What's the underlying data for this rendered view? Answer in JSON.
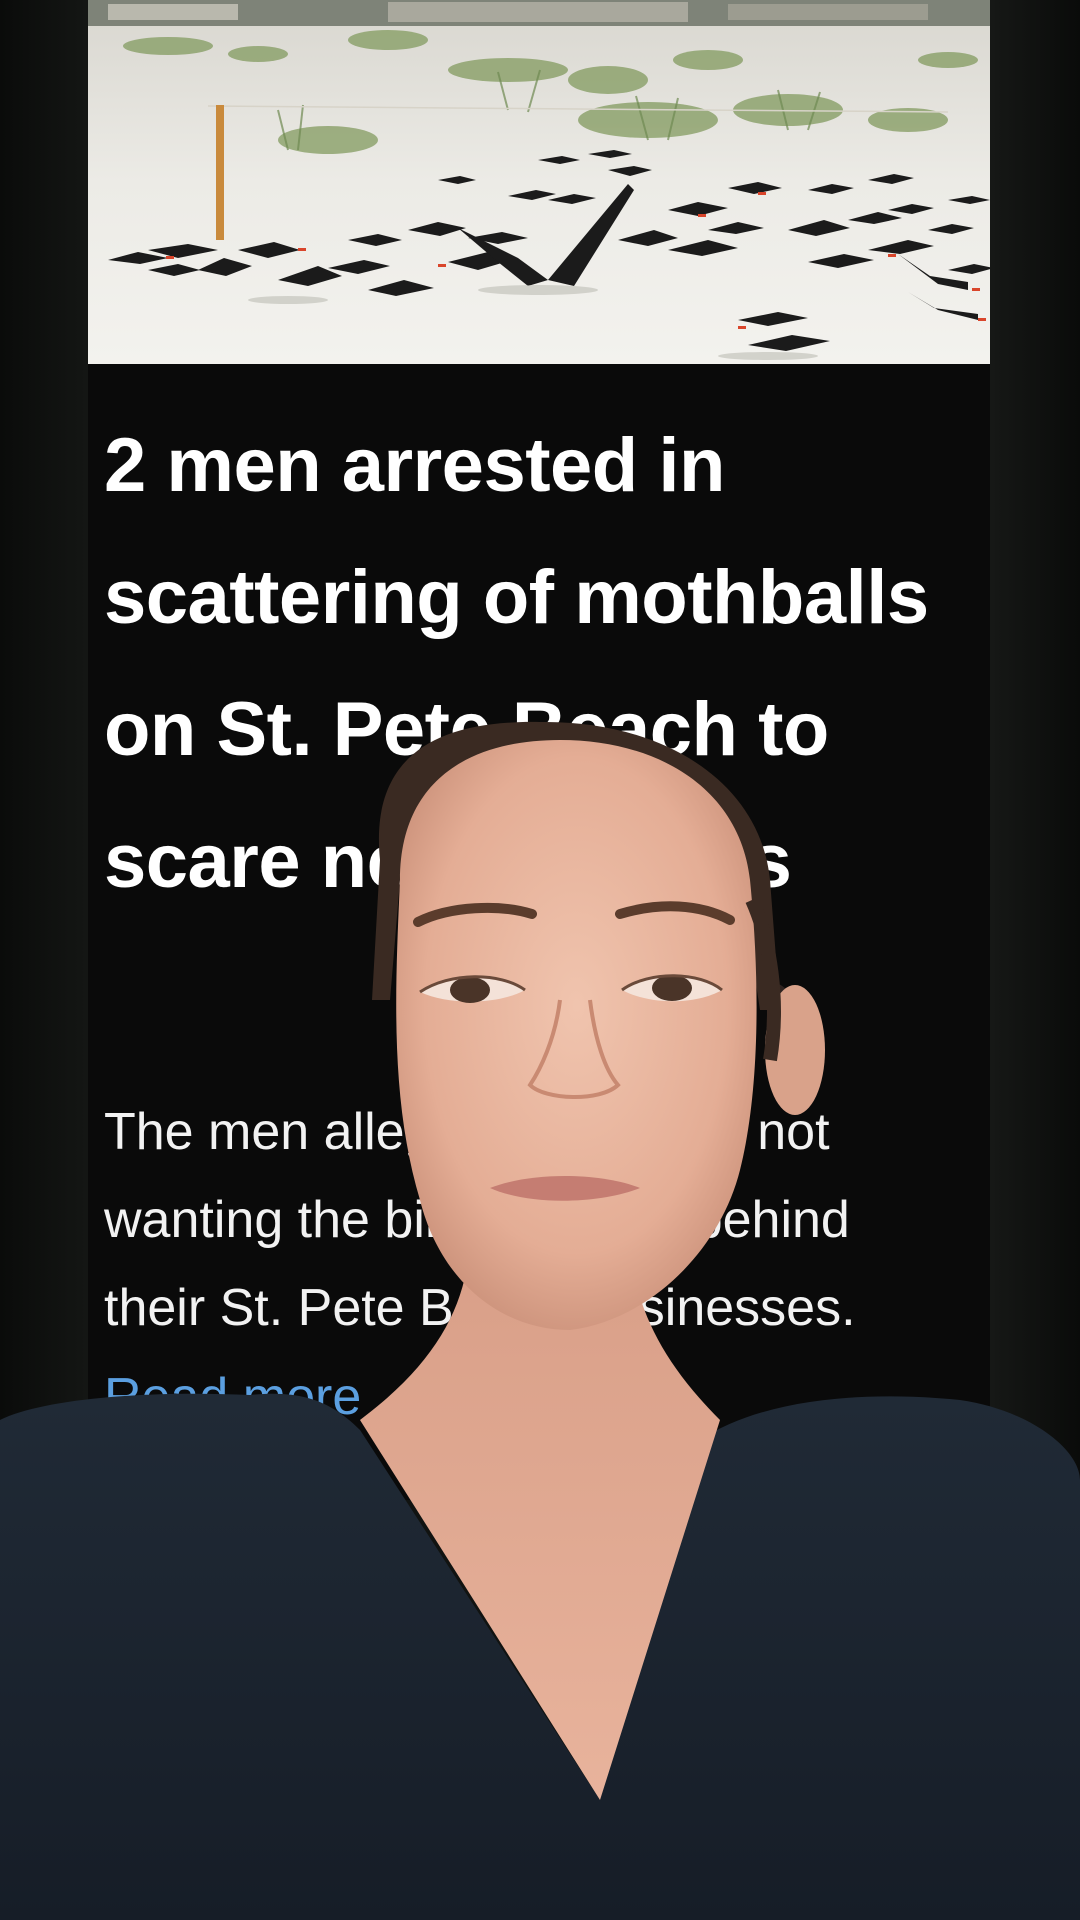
{
  "article": {
    "photo_subject": "flock of black skimmer birds resting on white sand beach with dune grass",
    "headline": "2 men arrested in scattering of mothballs on St. Pete Beach to scare nesting birds",
    "summary": "The men allegedly admitted not wanting the birds nesting behind their St. Pete Beach businesses.",
    "read_more": "Read more"
  },
  "colors": {
    "background": "#0a0a0a",
    "headline_text": "#ffffff",
    "body_text": "#f2f2f2",
    "link": "#5b9fe0",
    "shirt": "#1c2430",
    "skin": "#e9b6a0"
  }
}
